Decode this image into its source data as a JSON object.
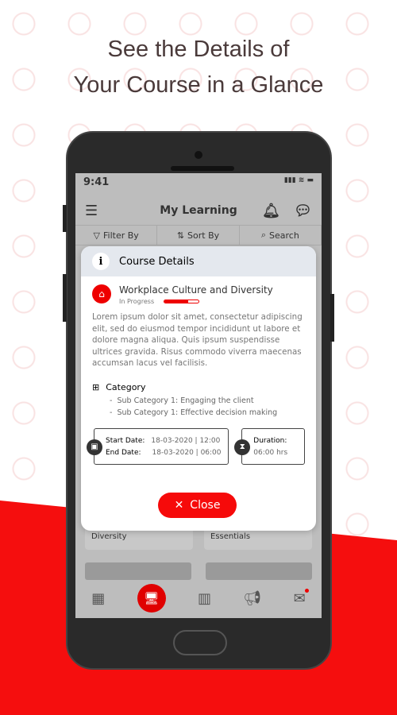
{
  "headline": {
    "line1": "See the Details of",
    "line2": "Your Course in a Glance"
  },
  "status": {
    "time": "9:41",
    "icons": "▮▮▮ ≋ ▬"
  },
  "appbar": {
    "title": "My Learning"
  },
  "toolbar": {
    "filter": "Filter By",
    "sort": "Sort By",
    "search": "Search"
  },
  "modal": {
    "title": "Course Details",
    "course_title": "Workplace Culture and Diversity",
    "status": "In Progress",
    "progress_percent": 70,
    "description": "Lorem ipsum dolor sit amet, consectetur adipiscing elit, sed do eiusmod tempor incididunt ut labore et dolore magna aliqua. Quis ipsum suspendisse ultrices gravida. Risus commodo viverra maecenas accumsan lacus vel facilisis.",
    "category_label": "Category",
    "subcategories": [
      "Sub Category 1: Engaging the client",
      "Sub Category 1: Effective decision making"
    ],
    "start_label": "Start Date:",
    "start_value": "18-03-2020  |  12:00",
    "end_label": "End Date:",
    "end_value": "18-03-2020  |  06:00",
    "duration_label": "Duration:",
    "duration_value": "06:00 hrs",
    "close_label": "Close"
  },
  "cards": [
    "Diversity",
    "Essentials"
  ],
  "colors": {
    "accent": "#f50e0e"
  }
}
